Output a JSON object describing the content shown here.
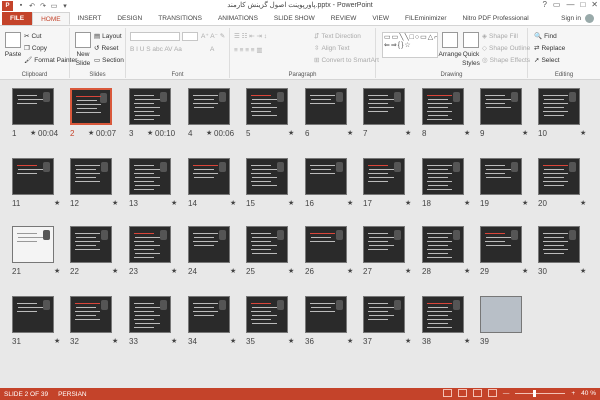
{
  "app": {
    "title": "پاورپوینت اصول گزینش کارمند.pptx - PowerPoint",
    "icon": "P",
    "qat": [
      "save-icon",
      "undo-icon",
      "redo-icon",
      "present-icon",
      "customize-icon"
    ],
    "controls": [
      "?",
      "▭",
      "—",
      "□",
      "✕"
    ]
  },
  "tabs": [
    {
      "label": "FILE"
    },
    {
      "label": "HOME"
    },
    {
      "label": "INSERT"
    },
    {
      "label": "DESIGN"
    },
    {
      "label": "TRANSITIONS"
    },
    {
      "label": "ANIMATIONS"
    },
    {
      "label": "SLIDE SHOW"
    },
    {
      "label": "REVIEW"
    },
    {
      "label": "VIEW"
    },
    {
      "label": "FILEminimizer"
    },
    {
      "label": "Nitro PDF Professional"
    }
  ],
  "signin": "Sign in",
  "ribbon": {
    "clipboard": {
      "label": "Clipboard",
      "paste": "Paste",
      "cut": "Cut",
      "copy": "Copy",
      "format_painter": "Format Painter"
    },
    "slides": {
      "label": "Slides",
      "new_slide": "New",
      "new_slide2": "Slide",
      "layout": "Layout",
      "reset": "Reset",
      "section": "Section"
    },
    "font": {
      "label": "Font"
    },
    "paragraph": {
      "label": "Paragraph",
      "text_direction": "Text Direction",
      "align_text": "Align Text",
      "convert": "Convert to SmartArt"
    },
    "drawing": {
      "label": "Drawing",
      "arrange": "Arrange",
      "quick_styles": "Quick",
      "quick_styles2": "Styles",
      "shape_fill": "Shape Fill",
      "shape_outline": "Shape Outline",
      "shape_effects": "Shape Effects",
      "shapes_glyphs": "▭▭╲╲□○▭△⌐⌐⇨⇩☆ ⇐⇒{}☆"
    },
    "editing": {
      "label": "Editing",
      "find": "Find",
      "replace": "Replace",
      "select": "Select"
    }
  },
  "slides": [
    {
      "num": "1",
      "time": "00:04",
      "star": "★"
    },
    {
      "num": "2",
      "time": "00:07",
      "star": "★"
    },
    {
      "num": "3",
      "time": "00:10",
      "star": "★"
    },
    {
      "num": "4",
      "time": "00:06",
      "star": "★"
    },
    {
      "num": "5",
      "star": "★"
    },
    {
      "num": "6",
      "star": "★"
    },
    {
      "num": "7",
      "star": "★"
    },
    {
      "num": "8",
      "star": "★"
    },
    {
      "num": "9",
      "star": "★"
    },
    {
      "num": "10",
      "star": "★"
    },
    {
      "num": "11",
      "star": "★"
    },
    {
      "num": "12",
      "star": "★"
    },
    {
      "num": "13",
      "star": "★"
    },
    {
      "num": "14",
      "star": "★"
    },
    {
      "num": "15",
      "star": "★"
    },
    {
      "num": "16",
      "star": "★"
    },
    {
      "num": "17",
      "star": "★"
    },
    {
      "num": "18",
      "star": "★"
    },
    {
      "num": "19",
      "star": "★"
    },
    {
      "num": "20",
      "star": "★"
    },
    {
      "num": "21",
      "star": "★"
    },
    {
      "num": "22",
      "star": "★"
    },
    {
      "num": "23",
      "star": "★"
    },
    {
      "num": "24",
      "star": "★"
    },
    {
      "num": "25",
      "star": "★"
    },
    {
      "num": "26",
      "star": "★"
    },
    {
      "num": "27",
      "star": "★"
    },
    {
      "num": "28",
      "star": "★"
    },
    {
      "num": "29",
      "star": "★"
    },
    {
      "num": "30",
      "star": "★"
    },
    {
      "num": "31",
      "star": "★"
    },
    {
      "num": "32",
      "star": "★"
    },
    {
      "num": "33",
      "star": "★"
    },
    {
      "num": "34",
      "star": "★"
    },
    {
      "num": "35",
      "star": "★"
    },
    {
      "num": "36",
      "star": "★"
    },
    {
      "num": "37",
      "star": "★"
    },
    {
      "num": "38",
      "star": "★"
    },
    {
      "num": "39",
      "star": ""
    }
  ],
  "status": {
    "slide": "SLIDE 2 OF 39",
    "language": "PERSIAN",
    "zoom": "40 %",
    "zoom_minus": "—",
    "zoom_plus": "+"
  },
  "colors": {
    "accent": "#c4432a",
    "selected_border": "#d9583b"
  }
}
